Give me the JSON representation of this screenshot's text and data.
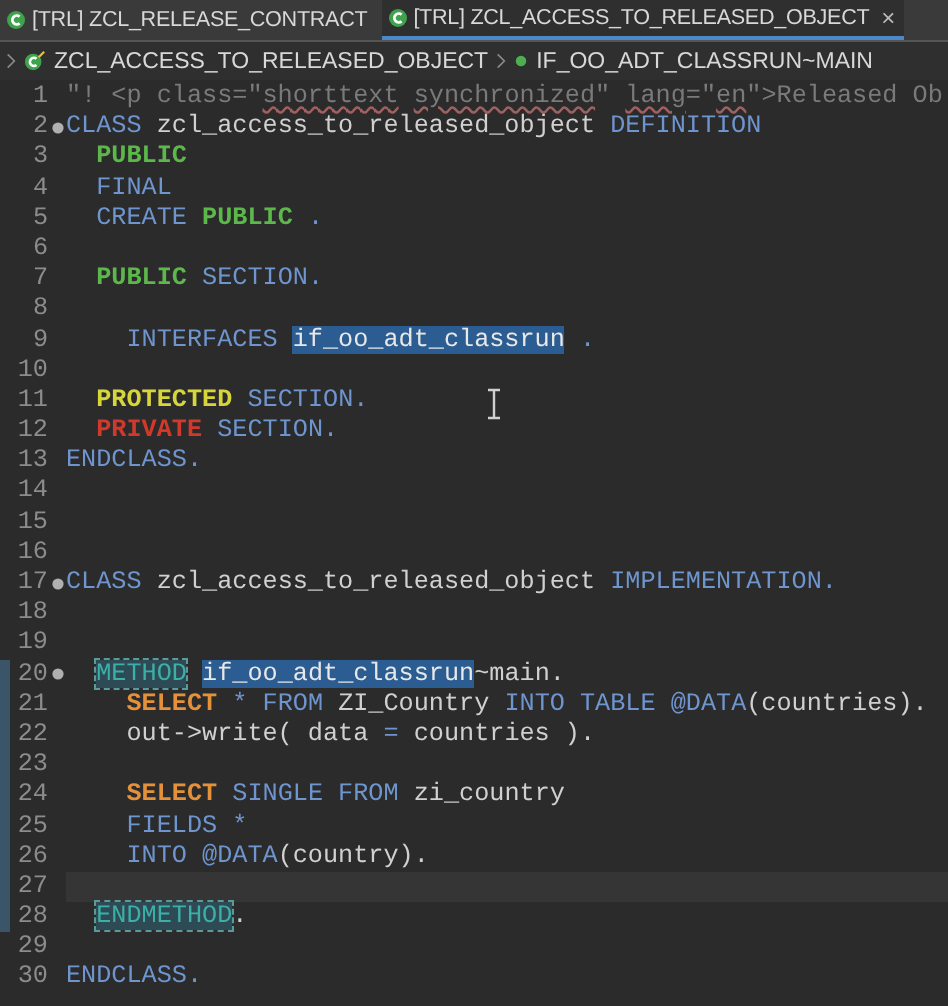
{
  "tabs": [
    {
      "label": "[TRL] ZCL_RELEASE_CONTRACT",
      "selected": false
    },
    {
      "label": "[TRL] ZCL_ACCESS_TO_RELEASED_OBJECT",
      "selected": true,
      "close": "×"
    }
  ],
  "breadcrumb": [
    {
      "kind": "class",
      "label": "ZCL_ACCESS_TO_RELEASED_OBJECT"
    },
    {
      "kind": "method",
      "label": "IF_OO_ADT_CLASSRUN~MAIN"
    }
  ],
  "lines": [
    {
      "number": "1",
      "fold": false,
      "current": false,
      "changed": false,
      "tokens": [
        {
          "kind": "comment",
          "text": "\"! <p class=\""
        },
        {
          "kind": "comment",
          "text": "shorttext",
          "misspelled": true
        },
        {
          "kind": "comment",
          "text": " synchronized",
          "misspelled": true
        },
        {
          "kind": "comment",
          "text": "\" "
        },
        {
          "kind": "comment",
          "text": "lang",
          "misspelled": true
        },
        {
          "kind": "comment",
          "text": "=\""
        },
        {
          "kind": "comment",
          "text": "en",
          "misspelled": true
        },
        {
          "kind": "comment",
          "text": "\">Released Ob"
        }
      ]
    },
    {
      "number": "2",
      "fold": true,
      "current": false,
      "changed": false,
      "tokens": [
        {
          "kind": "keyword",
          "text": "CLASS"
        },
        {
          "kind": "plain",
          "text": " zcl_access_to_released_object "
        },
        {
          "kind": "keyword",
          "text": "DEFINITION"
        }
      ]
    },
    {
      "number": "3",
      "fold": false,
      "current": false,
      "changed": false,
      "tokens": [
        {
          "kind": "public",
          "text": "  PUBLIC"
        }
      ]
    },
    {
      "number": "4",
      "fold": false,
      "current": false,
      "changed": false,
      "tokens": [
        {
          "kind": "keyword",
          "text": "  FINAL"
        }
      ]
    },
    {
      "number": "5",
      "fold": false,
      "current": false,
      "changed": false,
      "tokens": [
        {
          "kind": "keyword",
          "text": "  CREATE "
        },
        {
          "kind": "public",
          "text": "PUBLIC"
        },
        {
          "kind": "keyword",
          "text": " ."
        }
      ]
    },
    {
      "number": "6",
      "fold": false,
      "current": false,
      "changed": false
    },
    {
      "number": "7",
      "fold": false,
      "current": false,
      "changed": false,
      "tokens": [
        {
          "kind": "public",
          "text": "  PUBLIC"
        },
        {
          "kind": "keyword",
          "text": " SECTION."
        }
      ]
    },
    {
      "number": "8",
      "fold": false,
      "current": false,
      "changed": false
    },
    {
      "number": "9",
      "fold": false,
      "current": false,
      "changed": false,
      "tokens": [
        {
          "kind": "keyword",
          "text": "    INTERFACES "
        },
        {
          "kind": "plain",
          "text": "if_oo_adt_classrun",
          "highlighted": true
        },
        {
          "kind": "keyword",
          "text": " ."
        }
      ]
    },
    {
      "number": "10",
      "fold": false,
      "current": false,
      "changed": false
    },
    {
      "number": "11",
      "fold": false,
      "current": false,
      "changed": false,
      "tokens": [
        {
          "kind": "protected",
          "text": "  PROTECTED"
        },
        {
          "kind": "keyword",
          "text": " SECTION."
        }
      ]
    },
    {
      "number": "12",
      "fold": false,
      "current": false,
      "changed": false,
      "tokens": [
        {
          "kind": "private",
          "text": "  PRIVATE"
        },
        {
          "kind": "keyword",
          "text": " SECTION."
        }
      ]
    },
    {
      "number": "13",
      "fold": false,
      "current": false,
      "changed": false,
      "tokens": [
        {
          "kind": "keyword",
          "text": "ENDCLASS."
        }
      ]
    },
    {
      "number": "14",
      "fold": false,
      "current": false,
      "changed": false
    },
    {
      "number": "15",
      "fold": false,
      "current": false,
      "changed": false
    },
    {
      "number": "16",
      "fold": false,
      "current": false,
      "changed": false
    },
    {
      "number": "17",
      "fold": true,
      "current": false,
      "changed": false,
      "tokens": [
        {
          "kind": "keyword",
          "text": "CLASS"
        },
        {
          "kind": "plain",
          "text": " zcl_access_to_released_object "
        },
        {
          "kind": "keyword",
          "text": "IMPLEMENTATION."
        }
      ]
    },
    {
      "number": "18",
      "fold": false,
      "current": false,
      "changed": false
    },
    {
      "number": "19",
      "fold": false,
      "current": false,
      "changed": false
    },
    {
      "number": "20",
      "fold": true,
      "current": false,
      "changed": true,
      "tokens": [
        {
          "kind": "method",
          "text": "  METHOD",
          "occurrence": true
        },
        {
          "kind": "plain",
          "text": " if_oo_adt_classrun",
          "highlighted": true
        },
        {
          "kind": "plain",
          "text": "~main."
        }
      ]
    },
    {
      "number": "21",
      "fold": false,
      "current": false,
      "changed": true,
      "tokens": [
        {
          "kind": "sql",
          "text": "    SELECT"
        },
        {
          "kind": "keyword",
          "text": " * FROM "
        },
        {
          "kind": "plain",
          "text": "ZI_Country "
        },
        {
          "kind": "keyword",
          "text": "INTO TABLE @DATA"
        },
        {
          "kind": "plain",
          "text": "(countries)."
        }
      ]
    },
    {
      "number": "22",
      "fold": false,
      "current": false,
      "changed": true,
      "tokens": [
        {
          "kind": "plain",
          "text": "    out->write( data "
        },
        {
          "kind": "keyword",
          "text": "="
        },
        {
          "kind": "plain",
          "text": " countries )."
        }
      ]
    },
    {
      "number": "23",
      "fold": false,
      "current": false,
      "changed": true
    },
    {
      "number": "24",
      "fold": false,
      "current": false,
      "changed": true,
      "tokens": [
        {
          "kind": "sql",
          "text": "    SELECT"
        },
        {
          "kind": "keyword",
          "text": " SINGLE FROM "
        },
        {
          "kind": "plain",
          "text": "zi_country"
        }
      ]
    },
    {
      "number": "25",
      "fold": false,
      "current": false,
      "changed": true,
      "tokens": [
        {
          "kind": "keyword",
          "text": "    FIELDS *"
        }
      ]
    },
    {
      "number": "26",
      "fold": false,
      "current": false,
      "changed": true,
      "tokens": [
        {
          "kind": "keyword",
          "text": "    INTO @DATA"
        },
        {
          "kind": "plain",
          "text": "(country)."
        }
      ]
    },
    {
      "number": "27",
      "fold": false,
      "current": true,
      "changed": true
    },
    {
      "number": "28",
      "fold": false,
      "current": false,
      "changed": true,
      "tokens": [
        {
          "kind": "method",
          "text": "  ENDMETHOD",
          "occurrence": true
        },
        {
          "kind": "plain",
          "text": "."
        }
      ]
    },
    {
      "number": "29",
      "fold": false,
      "current": false,
      "changed": false
    },
    {
      "number": "30",
      "fold": false,
      "current": false,
      "changed": false,
      "tokens": [
        {
          "kind": "keyword",
          "text": "ENDCLASS."
        }
      ]
    }
  ]
}
